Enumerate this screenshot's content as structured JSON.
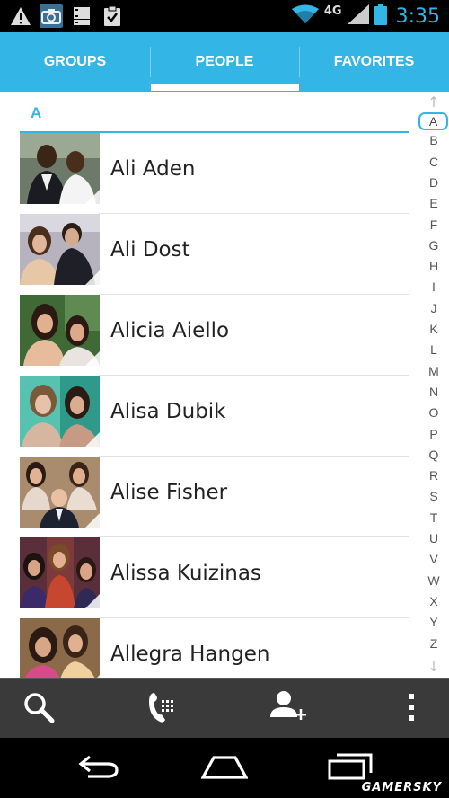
{
  "status_bar": {
    "icons": [
      "warning-icon",
      "camera-icon",
      "storage-icon",
      "clipboard-icon"
    ],
    "network_label": "4G",
    "time": "3:35"
  },
  "tabs": [
    {
      "label": "GROUPS",
      "selected": false
    },
    {
      "label": "PEOPLE",
      "selected": true
    },
    {
      "label": "FAVORITES",
      "selected": false
    }
  ],
  "section_header": "A",
  "contacts": [
    {
      "name": "Ali Aden"
    },
    {
      "name": "Ali Dost"
    },
    {
      "name": "Alicia Aiello"
    },
    {
      "name": "Alisa Dubik"
    },
    {
      "name": "Alise Fisher"
    },
    {
      "name": "Alissa Kuizinas"
    },
    {
      "name": "Allegra Hangen"
    }
  ],
  "alpha_index": {
    "up_arrow": "↑",
    "down_arrow": "↓",
    "letters": [
      "A",
      "B",
      "C",
      "D",
      "E",
      "F",
      "G",
      "H",
      "I",
      "J",
      "K",
      "L",
      "M",
      "N",
      "O",
      "P",
      "Q",
      "R",
      "S",
      "T",
      "U",
      "V",
      "W",
      "X",
      "Y",
      "Z"
    ],
    "selected": "A"
  },
  "action_bar": {
    "icons": [
      "search-icon",
      "dialpad-icon",
      "add-contact-icon",
      "overflow-menu-icon"
    ]
  },
  "nav_bar": {
    "icons": [
      "back-icon",
      "home-icon",
      "recents-icon"
    ]
  },
  "watermark": "GAMERSKY",
  "colors": {
    "accent": "#33b5e5",
    "action_bar": "#3a3a3a",
    "status_bar": "#000000"
  }
}
